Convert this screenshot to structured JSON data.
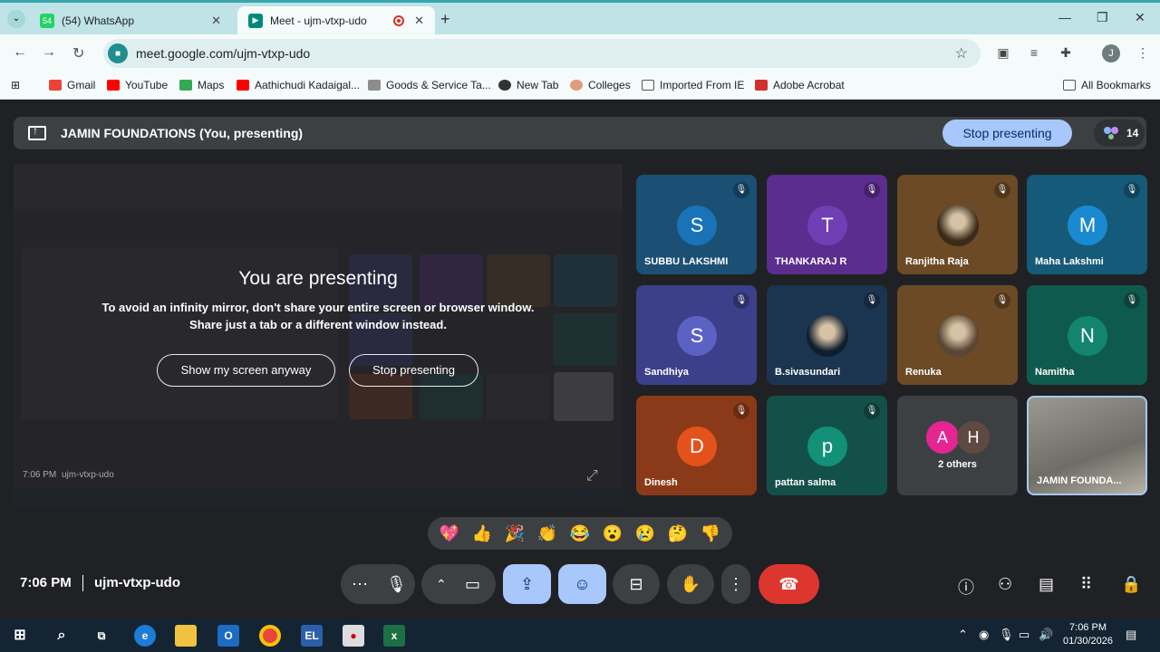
{
  "browser": {
    "tabs": [
      {
        "title": "(54) WhatsApp",
        "badge": "54"
      },
      {
        "title": "Meet - ujm-vtxp-udo"
      }
    ],
    "address": "meet.google.com/ujm-vtxp-udo",
    "profile_initial": "J",
    "bookmarks": [
      "Gmail",
      "YouTube",
      "Maps",
      "Aathichudi Kadaigal...",
      "Goods & Service Ta...",
      "New Tab",
      "Colleges",
      "Imported From IE",
      "Adobe Acrobat"
    ],
    "all_bookmarks": "All Bookmarks"
  },
  "meet": {
    "presenting_bar_title": "JAMIN FOUNDATIONS (You, presenting)",
    "stop_presenting": "Stop presenting",
    "participant_count": "14",
    "presenting_heading": "You are presenting",
    "presenting_sub1": "To avoid an infinity mirror, don't share your entire screen or browser window.",
    "presenting_sub2": "Share just a tab or a different window instead.",
    "show_anyway": "Show my screen anyway",
    "stop_presenting_btn": "Stop presenting",
    "mini_time": "7:06 PM",
    "mini_code": "ujm-vtxp-udo",
    "participants": [
      {
        "name": "SUBBU LAKSHMI",
        "initial": "S",
        "bg": "#1b4f74",
        "av": "#1a73b8"
      },
      {
        "name": "THANKARAJ R",
        "initial": "T",
        "bg": "#5b2d8e",
        "av": "#6f3fb3"
      },
      {
        "name": "Ranjitha Raja",
        "initial": "",
        "bg": "#6b4a25",
        "av": "#3b2b18"
      },
      {
        "name": "Maha Lakshmi",
        "initial": "M",
        "bg": "#155a78",
        "av": "#1a8ad0"
      },
      {
        "name": "Sandhiya",
        "initial": "S",
        "bg": "#3c3f8a",
        "av": "#5c62c4"
      },
      {
        "name": "B.sivasundari",
        "initial": "",
        "bg": "#1b3550",
        "av": "#0f1e2e"
      },
      {
        "name": "Renuka",
        "initial": "",
        "bg": "#6b4a25",
        "av": "#5a4632"
      },
      {
        "name": "Namitha",
        "initial": "N",
        "bg": "#0f5a4e",
        "av": "#13856f"
      },
      {
        "name": "Dinesh",
        "initial": "D",
        "bg": "#8a3a18",
        "av": "#e4521c"
      },
      {
        "name": "pattan salma",
        "initial": "p",
        "bg": "#13504a",
        "av": "#139178"
      },
      {
        "name": "2 others",
        "initial": "",
        "bg": "#3c4043",
        "av": ""
      },
      {
        "name": "JAMIN FOUNDA...",
        "initial": "",
        "bg": "#8c8c86",
        "av": ""
      }
    ],
    "others_initials": [
      "A",
      "H"
    ],
    "reactions": [
      "💖",
      "👍",
      "🎉",
      "👏",
      "😂",
      "😮",
      "😢",
      "🤔",
      "👎"
    ],
    "clock": "7:06 PM",
    "meeting_code": "ujm-vtxp-udo"
  },
  "taskbar": {
    "time": "7:06 PM",
    "date": "01/30/2026"
  }
}
